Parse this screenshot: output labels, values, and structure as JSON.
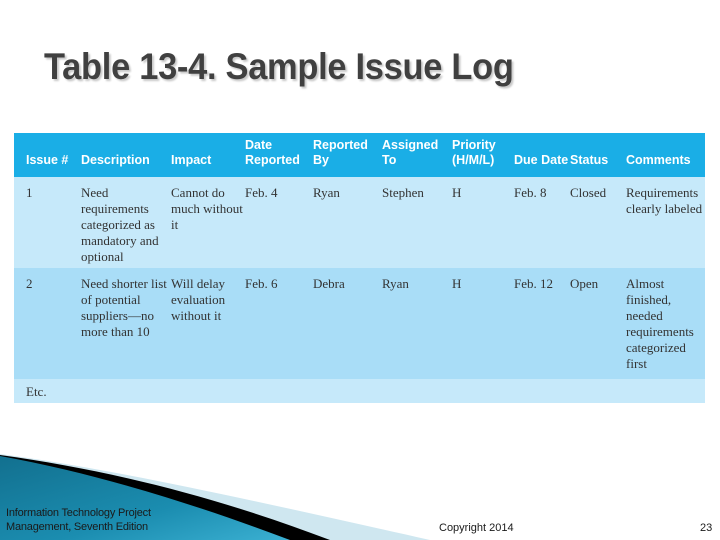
{
  "slide": {
    "title": "Table 13-4. Sample Issue Log"
  },
  "table": {
    "headers": [
      "Issue #",
      "Description",
      "Impact",
      "Date Reported",
      "Reported By",
      "Assigned To",
      "Priority (H/M/L)",
      "Due Date",
      "Status",
      "Comments"
    ],
    "rows": [
      {
        "issue": "1",
        "description": "Need requirements categorized as mandatory and optional",
        "impact": "Cannot do much without it",
        "date_reported": "Feb. 4",
        "reported_by": "Ryan",
        "assigned_to": "Stephen",
        "priority": "H",
        "due_date": "Feb. 8",
        "status": "Closed",
        "comments": "Requirements clearly labeled"
      },
      {
        "issue": "2",
        "description": "Need shorter list of potential suppliers—no more than 10",
        "impact": "Will delay evaluation without it",
        "date_reported": "Feb. 6",
        "reported_by": "Debra",
        "assigned_to": "Ryan",
        "priority": "H",
        "due_date": "Feb. 12",
        "status": "Open",
        "comments": "Almost finished, needed requirements categorized first"
      }
    ],
    "etc_label": "Etc."
  },
  "footer": {
    "book_line1": "Information Technology Project",
    "book_line2": "Management, Seventh Edition",
    "copyright": "Copyright 2014",
    "page_number": "23"
  },
  "colors": {
    "header_bg": "#1aaee6",
    "row_light": "#c6e9fa",
    "row_dark": "#a9ddf7",
    "title_text": "#404040",
    "swoosh_teal": "#1b87a8"
  }
}
